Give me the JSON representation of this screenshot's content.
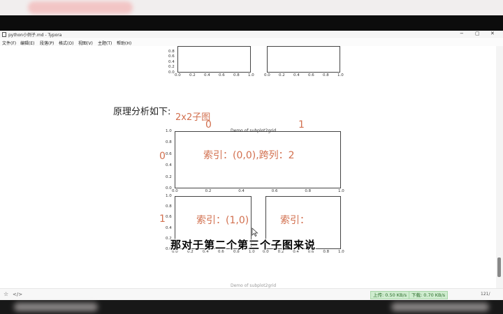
{
  "window": {
    "title": "python小例子.md - Typora",
    "controls": [
      "−",
      "▢",
      "✕"
    ]
  },
  "menu": [
    "文件(F)",
    "编辑(E)",
    "段落(P)",
    "格式(O)",
    "视图(V)",
    "主题(T)",
    "帮助(H)"
  ],
  "document": {
    "heading": "原理分析如下:",
    "annotations": {
      "grid_label": "2x2子图",
      "col0": "0",
      "col1": "1",
      "row0": "0",
      "row1": "1",
      "ax1": "索引：(0,0),跨列：2",
      "ax2": "索引：(1,0)",
      "ax3": "索引："
    },
    "figure_title": "Demo of subplot2grid",
    "bottom_figure_title": "Demo of subplot2grid",
    "ticks": {
      "x": [
        "0.0",
        "0.2",
        "0.4",
        "0.6",
        "0.8",
        "1.0"
      ],
      "y": [
        "0.0",
        "0.2",
        "0.4",
        "0.6",
        "0.8",
        "1.0"
      ]
    }
  },
  "subtitle_caption": "那对于第二个第三个子图来说",
  "statusbar": {
    "upload": "上传: 0.50 KB/s",
    "download": "下载: 0.70 KB/s",
    "word_count": "121/"
  }
}
